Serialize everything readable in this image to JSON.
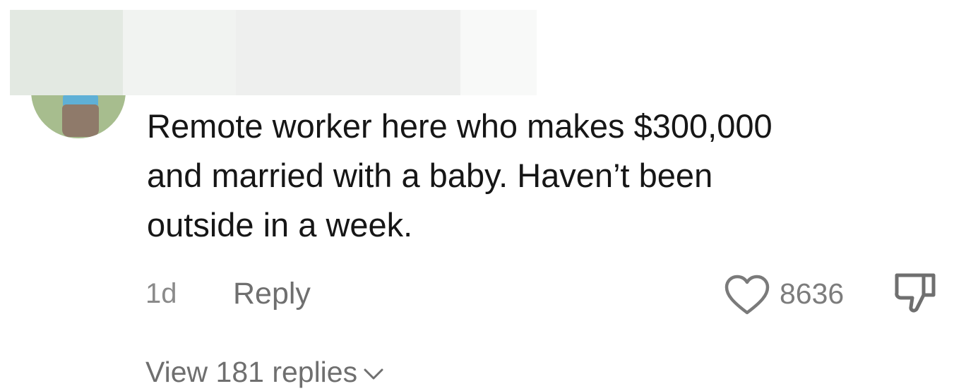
{
  "comment": {
    "text_line_1": "Remote worker here who makes $300,000",
    "text_line_2": "and married with a baby. Haven’t been",
    "text_line_3": "outside in a week.",
    "age": "1d",
    "reply_label": "Reply",
    "like_count": "8636",
    "view_replies_label": "View 181 replies"
  },
  "icons": {
    "like": "heart-outline-icon",
    "dislike": "thumbs-down-icon",
    "expand": "chevron-down-icon"
  },
  "colors": {
    "text_primary": "#161616",
    "text_secondary": "#6f6f6f",
    "icon_stroke": "#7a7a7a"
  }
}
